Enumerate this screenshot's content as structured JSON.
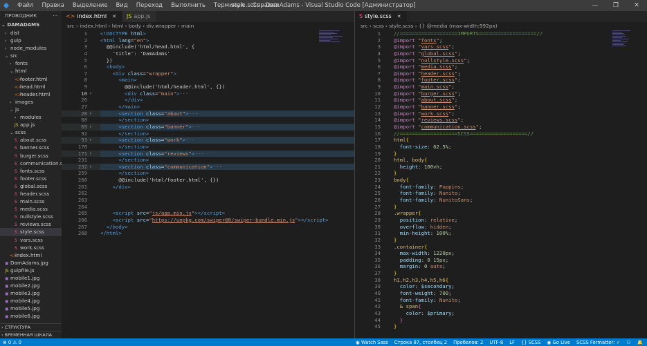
{
  "titlebar": {
    "menu": [
      "Файл",
      "Правка",
      "Выделение",
      "Вид",
      "Переход",
      "Выполнить",
      "Терминал",
      "Справка"
    ],
    "title": "style.scss - DamAdams - Visual Studio Code [Администратор]",
    "controls": [
      "—",
      "❐",
      "✕"
    ]
  },
  "sidebar": {
    "header": "ПРОВОДНИК",
    "more": "···",
    "root": "DAMADAMS",
    "items": [
      {
        "label": "dist",
        "depth": 1,
        "type": "folder",
        "open": false
      },
      {
        "label": "gulp",
        "depth": 1,
        "type": "folder",
        "open": false
      },
      {
        "label": "node_modules",
        "depth": 1,
        "type": "folder",
        "open": false
      },
      {
        "label": "src",
        "depth": 1,
        "type": "folder",
        "open": true
      },
      {
        "label": "fonts",
        "depth": 2,
        "type": "folder",
        "open": false
      },
      {
        "label": "html",
        "depth": 2,
        "type": "folder",
        "open": true
      },
      {
        "label": "footer.html",
        "depth": 3,
        "type": "html"
      },
      {
        "label": "head.html",
        "depth": 3,
        "type": "html"
      },
      {
        "label": "header.html",
        "depth": 3,
        "type": "html"
      },
      {
        "label": "images",
        "depth": 2,
        "type": "folder",
        "open": false
      },
      {
        "label": "js",
        "depth": 2,
        "type": "folder",
        "open": true
      },
      {
        "label": "modules",
        "depth": 3,
        "type": "folder",
        "open": false
      },
      {
        "label": "app.js",
        "depth": 3,
        "type": "js"
      },
      {
        "label": "scss",
        "depth": 2,
        "type": "folder",
        "open": true
      },
      {
        "label": "about.scss",
        "depth": 3,
        "type": "scss"
      },
      {
        "label": "banner.scss",
        "depth": 3,
        "type": "scss"
      },
      {
        "label": "burger.scss",
        "depth": 3,
        "type": "scss"
      },
      {
        "label": "communication.scss",
        "depth": 3,
        "type": "scss"
      },
      {
        "label": "fonts.scss",
        "depth": 3,
        "type": "scss"
      },
      {
        "label": "footer.scss",
        "depth": 3,
        "type": "scss"
      },
      {
        "label": "global.scss",
        "depth": 3,
        "type": "scss"
      },
      {
        "label": "header.scss",
        "depth": 3,
        "type": "scss"
      },
      {
        "label": "main.scss",
        "depth": 3,
        "type": "scss"
      },
      {
        "label": "media.scss",
        "depth": 3,
        "type": "scss"
      },
      {
        "label": "nullstyle.scss",
        "depth": 3,
        "type": "scss"
      },
      {
        "label": "reviews.scss",
        "depth": 3,
        "type": "scss"
      },
      {
        "label": "style.scss",
        "depth": 3,
        "type": "scss",
        "selected": true
      },
      {
        "label": "vars.scss",
        "depth": 3,
        "type": "scss"
      },
      {
        "label": "work.scss",
        "depth": 3,
        "type": "scss"
      },
      {
        "label": "index.html",
        "depth": 2,
        "type": "html"
      },
      {
        "label": "DamAdams.jpg",
        "depth": 1,
        "type": "img"
      },
      {
        "label": "gulpfile.js",
        "depth": 1,
        "type": "js"
      },
      {
        "label": "mobile1.jpg",
        "depth": 1,
        "type": "img"
      },
      {
        "label": "mobile2.jpg",
        "depth": 1,
        "type": "img"
      },
      {
        "label": "mobile3.jpg",
        "depth": 1,
        "type": "img"
      },
      {
        "label": "mobile4.jpg",
        "depth": 1,
        "type": "img"
      },
      {
        "label": "mobile5.jpg",
        "depth": 1,
        "type": "img"
      },
      {
        "label": "mobile6.jpg",
        "depth": 1,
        "type": "img"
      }
    ],
    "footer": [
      "СТРУКТУРА",
      "ВРЕМЕННАЯ ШКАЛА"
    ]
  },
  "left_editor": {
    "tabs": [
      {
        "label": "index.html",
        "icon": "<>",
        "icon_color": "#e37933",
        "active": true,
        "close": "✕"
      },
      {
        "label": "app.js",
        "icon": "JS",
        "icon_color": "#cbcb41",
        "active": false,
        "close": ""
      }
    ],
    "breadcrumb": [
      "src",
      "index.html",
      "html",
      "body",
      "div.wrapper",
      "main"
    ],
    "lines": [
      {
        "n": "1",
        "fold": "",
        "html": "<span class='tg'>&lt;!DOCTYPE</span> <span class='at'>html</span><span class='tg'>&gt;</span>"
      },
      {
        "n": "2",
        "fold": "",
        "html": "<span class='tg'>&lt;html</span> <span class='at'>lang</span>=<span class='st'>\"en\"</span><span class='tg'>&gt;</span>"
      },
      {
        "n": "3",
        "fold": "",
        "html": "  @@include('html/head.html', {"
      },
      {
        "n": "4",
        "fold": "",
        "html": "    'title': 'DamAdams'"
      },
      {
        "n": "5",
        "fold": "",
        "html": "  })"
      },
      {
        "n": "6",
        "fold": "",
        "html": "  <span class='tg'>&lt;body&gt;</span>"
      },
      {
        "n": "7",
        "fold": "",
        "html": "    <span class='tg'>&lt;div</span> <span class='at'>class</span>=<span class='st'>\"wrapper\"</span><span class='tg'>&gt;</span>"
      },
      {
        "n": "8",
        "fold": "",
        "html": "      <span class='tg'>&lt;main&gt;</span>"
      },
      {
        "n": "9",
        "fold": "",
        "html": "        @@include('html/header.html', {})"
      },
      {
        "n": "10",
        "fold": "›",
        "cur": true,
        "html": "        <span class='tg'>&lt;div</span> <span class='at'>class</span>=<span class='st'>\"main\"</span><span class='tg'>&gt;</span><span class='pc'>···</span>"
      },
      {
        "n": "26",
        "fold": "",
        "html": "        <span class='tg'>&lt;/div&gt;</span>"
      },
      {
        "n": "27",
        "fold": "",
        "html": "      <span class='tg'>&lt;/main&gt;</span>"
      },
      {
        "n": "28",
        "fold": "›",
        "hl": true,
        "html": "      <span class='tg'>&lt;section</span> <span class='at'>class</span>=<span class='st'>\"about\"</span><span class='tg'>&gt;</span><span class='pc'>···</span>"
      },
      {
        "n": "68",
        "fold": "",
        "html": "      <span class='tg'>&lt;/section&gt;</span>"
      },
      {
        "n": "69",
        "fold": "›",
        "hl": true,
        "html": "      <span class='tg'>&lt;section</span> <span class='at'>class</span>=<span class='st'>\"banner\"</span><span class='tg'>&gt;</span><span class='pc'>···</span>"
      },
      {
        "n": "92",
        "fold": "",
        "html": "      <span class='tg'>&lt;/section&gt;</span>"
      },
      {
        "n": "93",
        "fold": "›",
        "hl": true,
        "html": "      <span class='tg'>&lt;section</span> <span class='at'>class</span>=<span class='st'>\"work\"</span><span class='tg'>&gt;</span><span class='pc'>···</span>"
      },
      {
        "n": "170",
        "fold": "",
        "html": "      <span class='tg'>&lt;/section&gt;</span>"
      },
      {
        "n": "171",
        "fold": "›",
        "hl": true,
        "html": "      <span class='tg'>&lt;section</span> <span class='at'>class</span>=<span class='st'>\"reviews\"</span><span class='tg'>&gt;</span><span class='pc'>···</span>"
      },
      {
        "n": "231",
        "fold": "",
        "html": "      <span class='tg'>&lt;/section&gt;</span>"
      },
      {
        "n": "232",
        "fold": "›",
        "hl": true,
        "html": "      <span class='tg'>&lt;section</span> <span class='at'>class</span>=<span class='st'>\"communication\"</span><span class='tg'>&gt;</span><span class='pc'>···</span>"
      },
      {
        "n": "259",
        "fold": "",
        "html": "      <span class='tg'>&lt;/section&gt;</span>"
      },
      {
        "n": "260",
        "fold": "",
        "html": "      @@include('html/footer.html', {})"
      },
      {
        "n": "261",
        "fold": "",
        "html": "    <span class='tg'>&lt;/div&gt;</span>"
      },
      {
        "n": "262",
        "fold": "",
        "html": ""
      },
      {
        "n": "263",
        "fold": "",
        "html": ""
      },
      {
        "n": "264",
        "fold": "",
        "html": ""
      },
      {
        "n": "265",
        "fold": "",
        "html": "    <span class='tg'>&lt;script</span> <span class='at'>src</span>=<span class='st'>\"<u>js/app.min.js</u>\"</span><span class='tg'>&gt;&lt;/script&gt;</span>"
      },
      {
        "n": "266",
        "fold": "",
        "html": "    <span class='tg'>&lt;script</span> <span class='at'>src</span>=<span class='st'>\"<u>https://unpkg.com/swiper@8/swiper-bundle.min.js</u>\"</span><span class='tg'>&gt;&lt;/script&gt;</span>"
      },
      {
        "n": "267",
        "fold": "",
        "html": "  <span class='tg'>&lt;/body&gt;</span>"
      },
      {
        "n": "268",
        "fold": "",
        "html": "<span class='tg'>&lt;/html&gt;</span>"
      }
    ]
  },
  "right_editor": {
    "tabs": [
      {
        "label": "style.scss",
        "icon": "S",
        "icon_color": "#f55385",
        "active": true,
        "close": "✕"
      }
    ],
    "breadcrumb": [
      "src",
      "scss",
      "style.scss",
      "{} @media (max-width:992px)"
    ],
    "lines": [
      {
        "n": "1",
        "html": "<span class='cm'>//===================IMPORTS===================//</span>"
      },
      {
        "n": "2",
        "html": "<span class='kw'>@import</span> <span class='st'>\"<u>fonts</u>\"</span>;"
      },
      {
        "n": "3",
        "html": "<span class='kw'>@import</span> <span class='st'>\"<u>vars.scss</u>\"</span>;"
      },
      {
        "n": "4",
        "html": "<span class='kw'>@import</span> <span class='st'>\"<u>global.scss</u>\"</span>;"
      },
      {
        "n": "5",
        "html": "<span class='kw'>@import</span> <span class='st'>\"<u>nullstyle.scss</u>\"</span>;"
      },
      {
        "n": "6",
        "html": "<span class='kw'>@import</span> <span class='st'>\"<u>media.scss</u>\"</span>;"
      },
      {
        "n": "7",
        "html": "<span class='kw'>@import</span> <span class='st'>\"<u>header.scss</u>\"</span>;"
      },
      {
        "n": "8",
        "html": "<span class='kw'>@import</span> <span class='st'>\"<u>footer.scss</u>\"</span>;"
      },
      {
        "n": "9",
        "html": "<span class='kw'>@import</span> <span class='st'>\"<u>main.scss</u>\"</span>;"
      },
      {
        "n": "10",
        "html": "<span class='kw'>@import</span> <span class='st'>\"<u>burger.scss</u>\"</span>;"
      },
      {
        "n": "11",
        "html": "<span class='kw'>@import</span> <span class='st'>\"<u>about.scss</u>\"</span>;"
      },
      {
        "n": "12",
        "html": "<span class='kw'>@import</span> <span class='st'>\"<u>banner.scss</u>\"</span>;"
      },
      {
        "n": "13",
        "html": "<span class='kw'>@import</span> <span class='st'>\"<u>work.scss</u>\"</span>;"
      },
      {
        "n": "14",
        "html": "<span class='kw'>@import</span> <span class='st'>\"<u>reviews.scss</u>\"</span>;"
      },
      {
        "n": "15",
        "html": "<span class='kw'>@import</span> <span class='st'>\"<u>communication.scss</u>\"</span>;"
      },
      {
        "n": "16",
        "html": "<span class='cm'>//===================SCSS===================//</span>"
      },
      {
        "n": "17",
        "html": "<span class='sl'>html</span><span class='yl'>{</span>"
      },
      {
        "n": "18",
        "html": "  <span class='pr'>font-size</span>: <span class='nm'>62.5%</span>;"
      },
      {
        "n": "19",
        "html": "<span class='yl'>}</span>"
      },
      {
        "n": "20",
        "html": "<span class='sl'>html</span>, <span class='sl'>body</span><span class='yl'>{</span>"
      },
      {
        "n": "21",
        "html": "  <span class='pr'>height</span>: <span class='nm'>100vh</span>;"
      },
      {
        "n": "22",
        "html": "<span class='yl'>}</span>"
      },
      {
        "n": "23",
        "html": "<span class='sl'>body</span><span class='yl'>{</span>"
      },
      {
        "n": "24",
        "html": "  <span class='pr'>font-family</span>: <span class='vl'>Poppins</span>;"
      },
      {
        "n": "25",
        "html": "  <span class='pr'>font-family</span>: <span class='vl'>Nunito</span>;"
      },
      {
        "n": "26",
        "html": "  <span class='pr'>font-family</span>: <span class='vl'>NunitoSans</span>;"
      },
      {
        "n": "27",
        "html": "<span class='yl'>}</span>"
      },
      {
        "n": "28",
        "html": "<span class='sl'>.wrapper</span><span class='yl'>{</span>"
      },
      {
        "n": "29",
        "html": "  <span class='pr'>position</span>: <span class='vl'>relative</span>;"
      },
      {
        "n": "30",
        "html": "  <span class='pr'>overflow</span>: <span class='vl'>hidden</span>;"
      },
      {
        "n": "31",
        "html": "  <span class='pr'>min-height</span>: <span class='nm'>100%</span>;"
      },
      {
        "n": "32",
        "html": "<span class='yl'>}</span>"
      },
      {
        "n": "33",
        "html": "<span class='sl'>.container</span><span class='yl'>{</span>"
      },
      {
        "n": "34",
        "html": "  <span class='pr'>max-width</span>: <span class='nm'>1220px</span>;"
      },
      {
        "n": "35",
        "html": "  <span class='pr'>padding</span>: <span class='nm'>0 15px</span>;"
      },
      {
        "n": "36",
        "html": "  <span class='pr'>margin</span>: <span class='nm'>0</span> <span class='vl'>auto</span>;"
      },
      {
        "n": "37",
        "html": "<span class='yl'>}</span>"
      },
      {
        "n": "38",
        "html": "<span class='sl'>h1,h2,h3,h4,h5,h6</span><span class='yl'>{</span>"
      },
      {
        "n": "39",
        "html": "  <span class='pr'>color</span>: <span class='pr'>$secondary</span>;"
      },
      {
        "n": "40",
        "html": "  <span class='pr'>font-weight</span>: <span class='nm'>700</span>;"
      },
      {
        "n": "41",
        "html": "  <span class='pr'>font-family</span>: <span class='vl'>Nunito</span>;"
      },
      {
        "n": "42",
        "html": "  <span class='sl'>&amp; span</span><span class='pk'>{</span>"
      },
      {
        "n": "43",
        "html": "    <span class='pr'>color</span>: <span class='pr'>$primary</span>;"
      },
      {
        "n": "44",
        "html": "  <span class='pk'>}</span>"
      },
      {
        "n": "45",
        "html": "<span class='yl'>}</span>"
      }
    ]
  },
  "statusbar": {
    "left": [
      "⊗ 0 ⚠ 0"
    ],
    "right": [
      "◉ Watch Sass",
      "Строка 87, столбец 2",
      "Пробелов: 2",
      "UTF-8",
      "LF",
      "{} SCSS",
      "◉ Go Live",
      "SCSS Formatter: ✓",
      "⚇",
      "🔔"
    ]
  }
}
